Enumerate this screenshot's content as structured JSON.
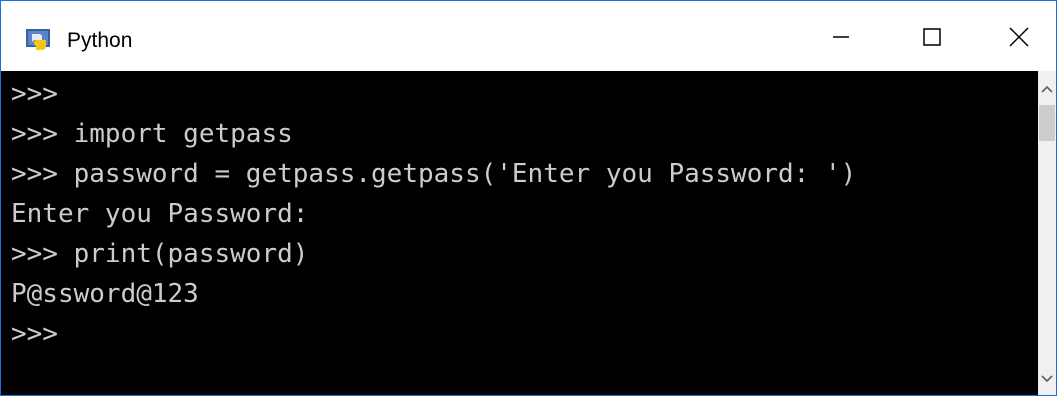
{
  "window": {
    "title": "Python",
    "icon": "python-icon",
    "controls": {
      "minimize": "minimize-icon",
      "maximize": "maximize-icon",
      "close": "close-icon"
    }
  },
  "console": {
    "lines": [
      ">>>",
      ">>> import getpass",
      ">>> password = getpass.getpass('Enter you Password: ')",
      "Enter you Password:",
      ">>> print(password)",
      "P@ssword@123",
      ">>>"
    ]
  },
  "scrollbar": {
    "up_icon": "chevron-up-icon",
    "down_icon": "chevron-down-icon"
  },
  "colors": {
    "console_background": "#000000",
    "console_text": "#cccccc",
    "window_border": "#1e6fd9",
    "titlebar": "#ffffff"
  }
}
